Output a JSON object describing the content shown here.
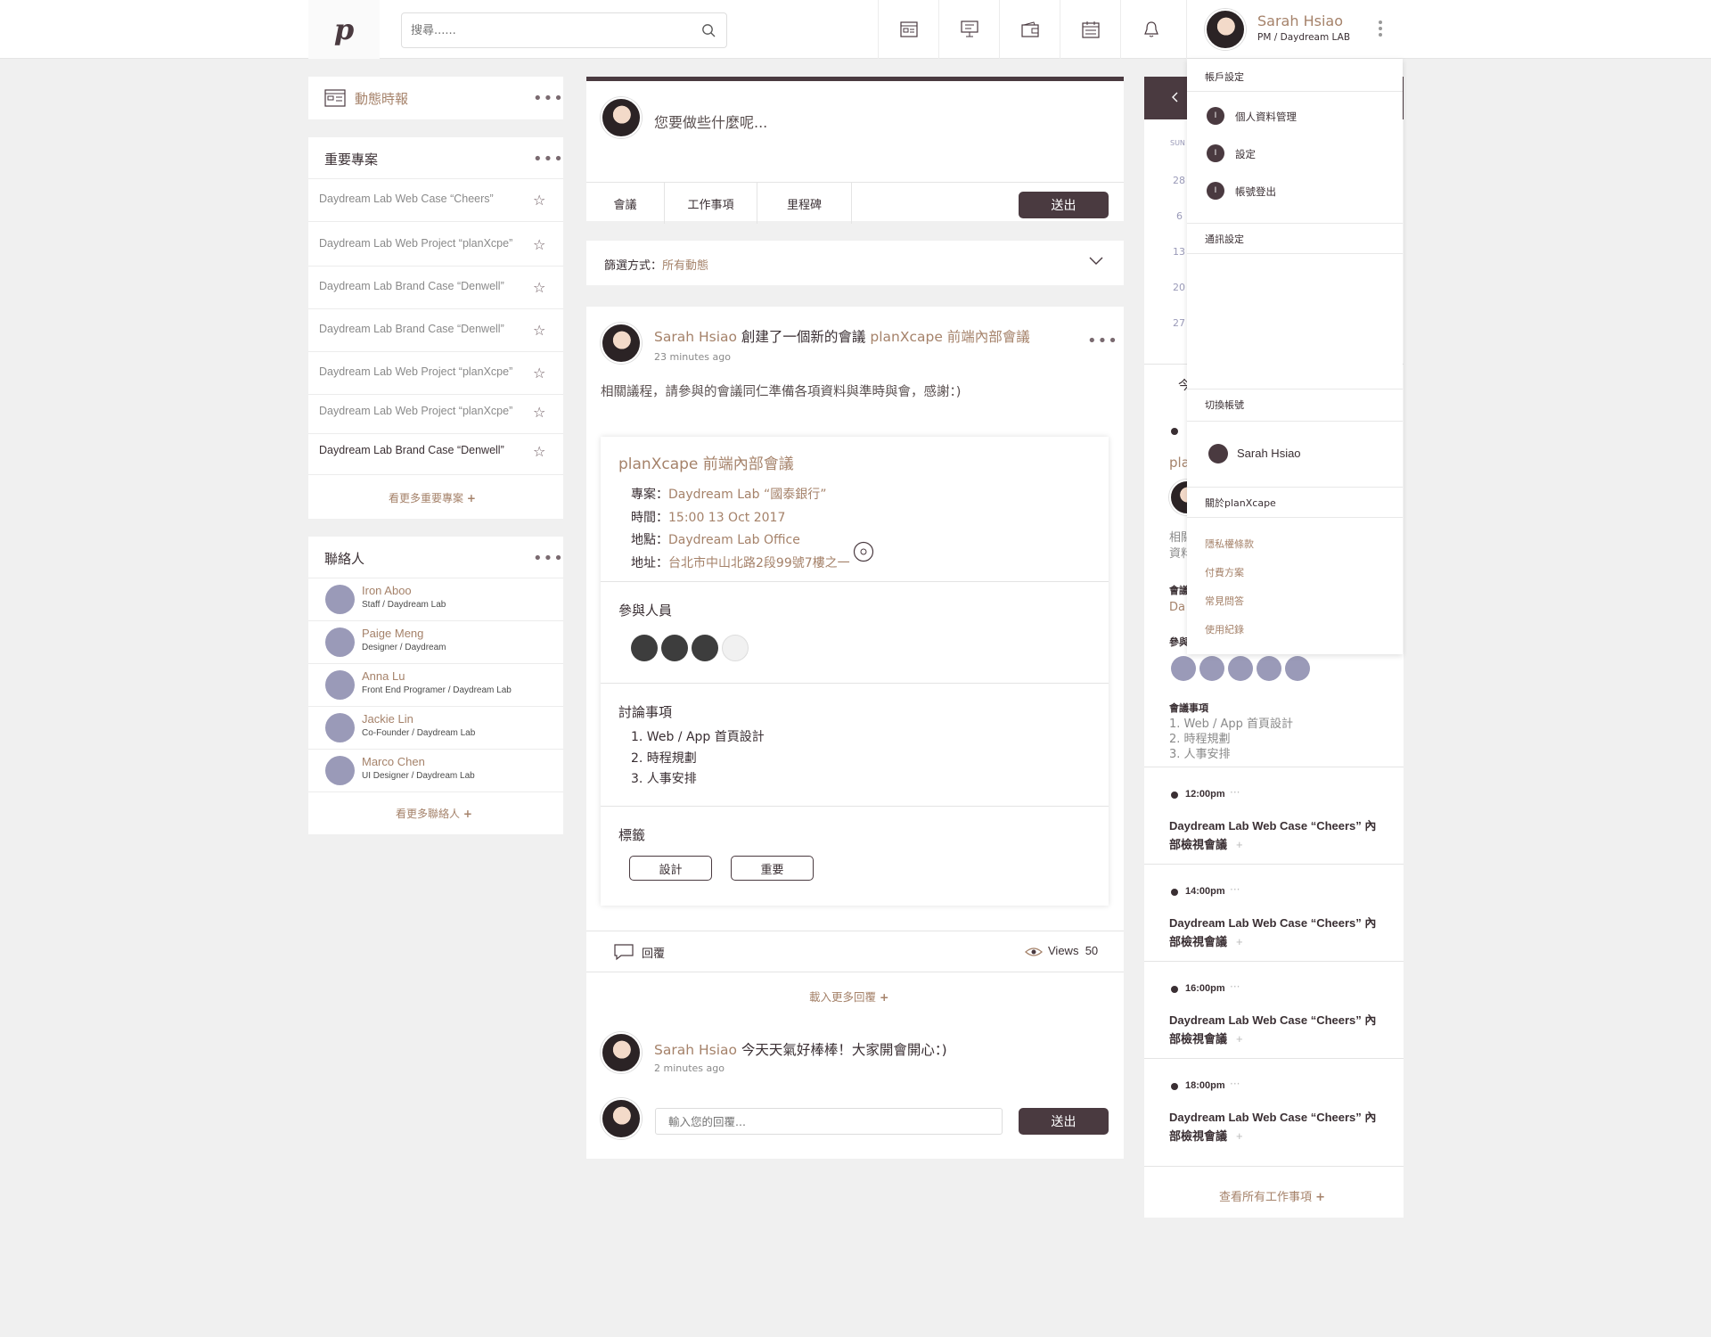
{
  "header": {
    "logo": "p",
    "search_placeholder": "搜尋......",
    "nav_icons": [
      "news-icon",
      "presentation-icon",
      "wallet-icon",
      "calendar-icon",
      "bell-icon"
    ],
    "user_name": "Sarah Hsiao",
    "user_role": "PM / Daydream LAB"
  },
  "left": {
    "news_title": "動態時報",
    "projects_title": "重要專案",
    "projects": [
      "Daydream Lab Web Case “Cheers”",
      "Daydream Lab Web Project “planXcpe”",
      "Daydream Lab Brand Case “Denwell”",
      "Daydream Lab Brand Case “Denwell”",
      "Daydream Lab Web Project “planXcpe”",
      "Daydream Lab Web Project “planXcpe”",
      "Daydream Lab Brand Case “Denwell”"
    ],
    "projects_more": "看更多重要專案",
    "contacts_title": "聯絡人",
    "contacts": [
      {
        "name": "Iron Aboo",
        "role": "Staff / Daydream Lab"
      },
      {
        "name": "Paige Meng",
        "role": "Designer / Daydream"
      },
      {
        "name": "Anna Lu",
        "role": "Front End Programer / Daydream Lab"
      },
      {
        "name": "Jackie Lin",
        "role": "Co-Founder / Daydream Lab"
      },
      {
        "name": "Marco Chen",
        "role": "UI Designer / Daydream Lab"
      }
    ],
    "contacts_more": "看更多聯絡人"
  },
  "composer": {
    "placeholder": "您要做些什麼呢...",
    "tabs": [
      "會議",
      "工作事項",
      "里程碑"
    ],
    "submit": "送出"
  },
  "filter": {
    "label": "篩選方式：",
    "value": "所有動態"
  },
  "post": {
    "author": "Sarah Hsiao",
    "action": "創建了一個新的會議",
    "target": "planXcape 前端內部會議",
    "time": "23 minutes ago",
    "body": "相關議程，請參與的會議同仁準備各項資料與準時與會，感謝：)",
    "meeting": {
      "title": "planXcape 前端內部會議",
      "project_label": "專案：",
      "project": "Daydream Lab “國泰銀行”",
      "time_label": "時間：",
      "time": "15:00 13 Oct 2017",
      "place_label": "地點：",
      "place": "Daydream Lab Office",
      "addr_label": "地址：",
      "addr": "台北市中山北路2段99號7樓之一",
      "participants_title": "參與人員",
      "topics_title": "討論事項",
      "topics": [
        "1.  Web / App 首頁設計",
        "2.  時程規劃",
        "3.  人事安排"
      ],
      "tags_title": "標籤",
      "tags": [
        "設計",
        "重要"
      ]
    },
    "reply_label": "回覆",
    "views_label": "Views",
    "views": "50",
    "load_more": "載入更多回覆",
    "comment": {
      "author": "Sarah Hsiao",
      "text": "今天天氣好棒棒！大家開會開心：)",
      "time": "2 minutes ago"
    },
    "reply_placeholder": "輸入您的回覆...",
    "reply_submit": "送出"
  },
  "dropdown": {
    "account_title": "帳戶設定",
    "account_items": [
      "個人資料管理",
      "設定",
      "帳號登出"
    ],
    "badge": "I",
    "notify_title": "通訊設定",
    "switch_title": "切換帳號",
    "switch_user": "Sarah Hsiao",
    "about_title": "關於planXcape",
    "links": [
      "隱私權條款",
      "付費方案",
      "常見問答",
      "使用紀錄"
    ]
  },
  "right": {
    "cal_day": "SUN",
    "cal_dates": [
      "28",
      "6",
      "13",
      "20",
      "27"
    ],
    "today_partial": "今",
    "post_partial": "pla",
    "body_partial_1": "相關",
    "body_partial_2": "資料",
    "meeting_label": "會議",
    "meeting_partial": "Da",
    "participants_label": "參與",
    "topics_title": "會議事項",
    "topics": [
      "1. Web / App 首頁設計",
      "2. 時程規劃",
      "3. 人事安排"
    ],
    "events": [
      {
        "time": "12:00pm",
        "title_1": "Daydream Lab Web Case “Cheers” 內",
        "title_2": "部檢視會議"
      },
      {
        "time": "14:00pm",
        "title_1": "Daydream Lab Web Case “Cheers” 內",
        "title_2": "部檢視會議"
      },
      {
        "time": "16:00pm",
        "title_1": "Daydream Lab Web Case “Cheers” 內",
        "title_2": "部檢視會議"
      },
      {
        "time": "18:00pm",
        "title_1": "Daydream Lab Web Case “Cheers” 內",
        "title_2": "部檢視會議"
      }
    ],
    "all_link": "查看所有工作事項"
  },
  "colors": {
    "accent": "#a5826a",
    "dark": "#4a3a40",
    "contact_avatar": "#9a9ab8"
  }
}
